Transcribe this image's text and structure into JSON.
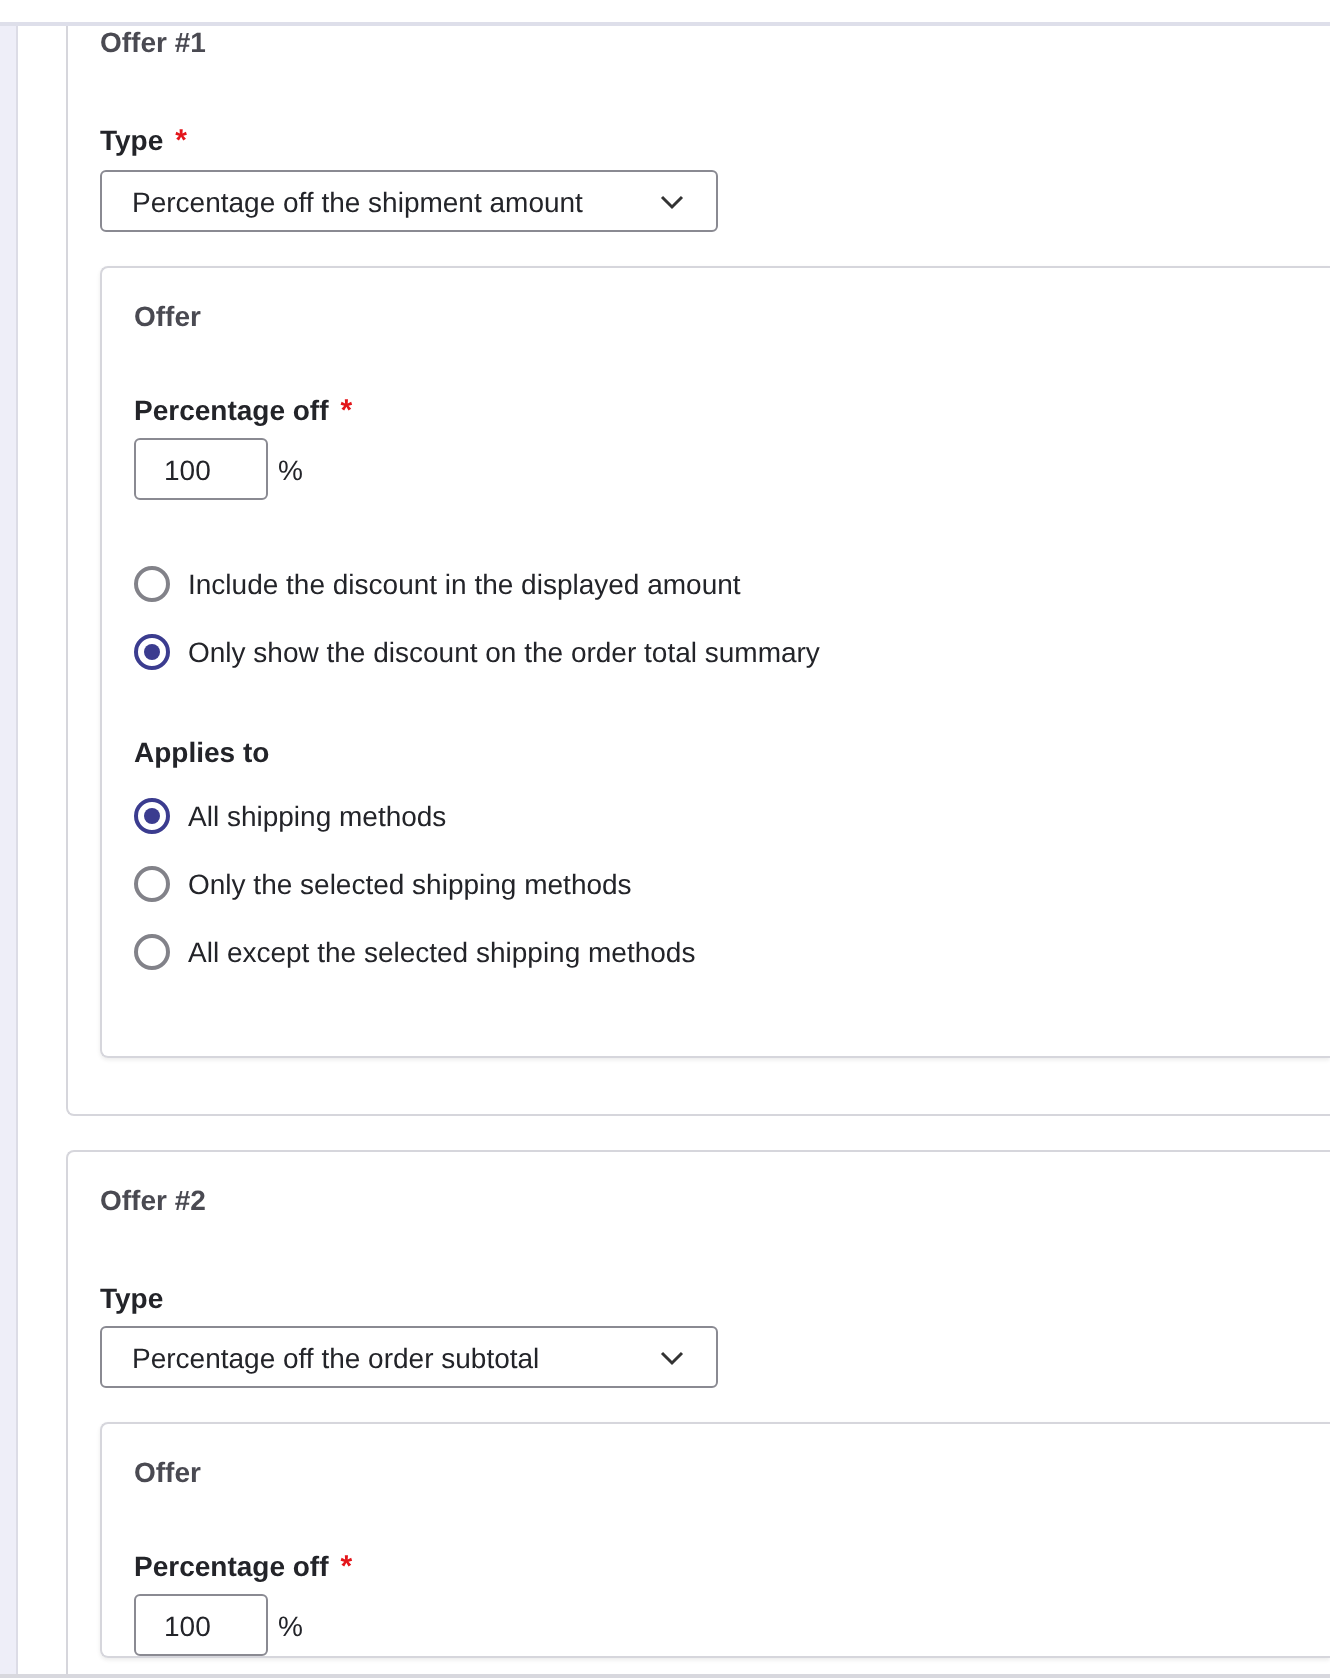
{
  "offers": [
    {
      "title": "Offer #1",
      "type_field": {
        "label": "Type",
        "required_marker": "*",
        "value": "Percentage off the shipment amount"
      },
      "offer": {
        "title": "Offer",
        "percentage": {
          "label": "Percentage off",
          "required_marker": "*",
          "value": "100",
          "unit": "%"
        },
        "display_options": [
          {
            "label": "Include the discount in the displayed amount",
            "selected": false
          },
          {
            "label": "Only show the discount on the order total summary",
            "selected": true
          }
        ],
        "applies_to": {
          "label": "Applies to",
          "options": [
            {
              "label": "All shipping methods",
              "selected": true
            },
            {
              "label": "Only the selected shipping methods",
              "selected": false
            },
            {
              "label": "All except the selected shipping methods",
              "selected": false
            }
          ]
        }
      }
    },
    {
      "title": "Offer #2",
      "type_field": {
        "label": "Type",
        "value": "Percentage off the order subtotal"
      },
      "offer": {
        "title": "Offer",
        "percentage": {
          "label": "Percentage off",
          "required_marker": "*",
          "value": "100",
          "unit": "%"
        }
      }
    }
  ]
}
